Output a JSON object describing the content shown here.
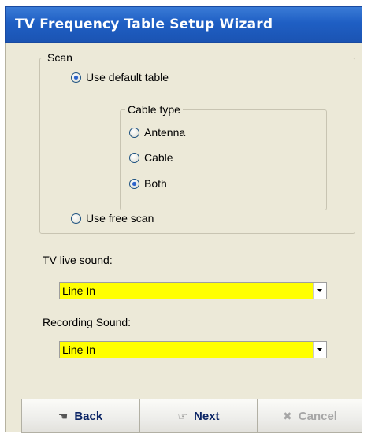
{
  "window": {
    "title": "TV Frequency Table Setup Wizard"
  },
  "scan": {
    "legend": "Scan",
    "use_default_table": {
      "label": "Use default table",
      "checked": true
    },
    "cable_type": {
      "legend": "Cable type",
      "options": [
        {
          "label": "Antenna",
          "checked": false
        },
        {
          "label": "Cable",
          "checked": false
        },
        {
          "label": "Both",
          "checked": true
        }
      ]
    },
    "use_free_scan": {
      "label": "Use free scan",
      "checked": false
    }
  },
  "tv_live_sound": {
    "label": "TV live sound:",
    "value": "Line In"
  },
  "recording_sound": {
    "label": "Recording Sound:",
    "value": "Line In"
  },
  "buttons": {
    "back": {
      "label": "Back",
      "icon": "back-hand-icon"
    },
    "next": {
      "label": "Next",
      "icon": "next-hand-icon"
    },
    "cancel": {
      "label": "Cancel",
      "icon": "x-icon",
      "enabled": false
    }
  },
  "colors": {
    "titlebar": "#1f5fc4",
    "client": "#ece9d8",
    "combo_highlight": "#ffff00",
    "button_text": "#0a2465"
  }
}
